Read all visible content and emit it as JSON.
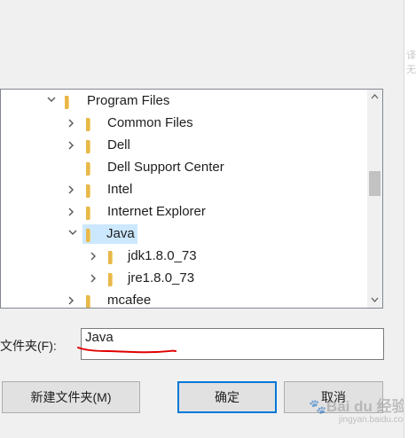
{
  "tree": {
    "items": [
      {
        "label": "Program Files",
        "expanded": true,
        "has_chevron": true
      },
      {
        "label": "Common Files",
        "expanded": false,
        "has_chevron": true
      },
      {
        "label": "Dell",
        "expanded": false,
        "has_chevron": true
      },
      {
        "label": "Dell Support Center",
        "expanded": false,
        "has_chevron": false
      },
      {
        "label": "Intel",
        "expanded": false,
        "has_chevron": true
      },
      {
        "label": "Internet Explorer",
        "expanded": false,
        "has_chevron": true
      },
      {
        "label": "Java",
        "expanded": true,
        "has_chevron": true,
        "selected": true
      },
      {
        "label": "jdk1.8.0_73",
        "expanded": false,
        "has_chevron": true
      },
      {
        "label": "jre1.8.0_73",
        "expanded": false,
        "has_chevron": true
      },
      {
        "label": "mcafee",
        "expanded": false,
        "has_chevron": true
      }
    ]
  },
  "folder_field": {
    "label": "文件夹(F):",
    "value": "Java"
  },
  "buttons": {
    "new_folder": "新建文件夹(M)",
    "ok": "确定",
    "cancel": "取消"
  },
  "watermark": {
    "main": "Bai du 经验",
    "sub": "jingyan.baidu.com"
  },
  "right_strip_text": "译无",
  "colors": {
    "selection": "#cce8ff",
    "folder": "#e8b84a",
    "primary_border": "#0078d7",
    "annotation": "#e00000"
  },
  "icons": {
    "folder": "folder-icon",
    "chevron_right": "chevron-right-icon",
    "chevron_down": "chevron-down-icon",
    "scroll_up": "scroll-up-icon",
    "scroll_down": "scroll-down-icon"
  }
}
